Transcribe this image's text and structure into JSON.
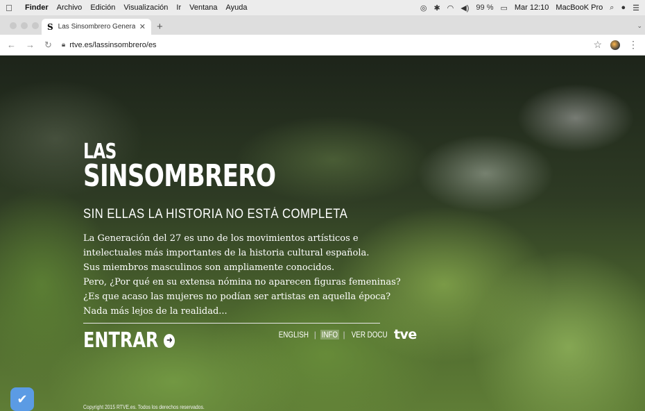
{
  "menubar": {
    "app_name": "Finder",
    "items": [
      "Archivo",
      "Edición",
      "Visualización",
      "Ir",
      "Ventana",
      "Ayuda"
    ],
    "battery": "99 %",
    "clock": "Mar 12:10",
    "computer_name": "MacBooK Pro"
  },
  "browser": {
    "tab_title": "Las Sinsombrero Generación d",
    "url": "rtve.es/lassinsombrero/es"
  },
  "page": {
    "logo_line1": "LAS",
    "logo_line2": "SINSOMBRERO",
    "tagline": "SIN ELLAS LA HISTORIA NO ESTÁ COMPLETA",
    "intro_lines": [
      "La Generación del 27 es uno de los movimientos artísticos e",
      "intelectuales más importantes de la historia cultural española.",
      "Sus miembros masculinos son ampliamente conocidos.",
      "Pero, ¿Por qué en su extensa nómina no aparecen figuras femeninas?",
      "¿Es que acaso las mujeres no podían ser artistas en aquella época?",
      "Nada más lejos de la realidad..."
    ],
    "enter_label": "ENTRAR",
    "links": {
      "english": "ENGLISH",
      "info": "INFO",
      "ver_docu": "VER DOCU",
      "brand": "tve"
    },
    "copyright": "Copyright 2015 RTVE.es. Todos los derechos reservados."
  }
}
